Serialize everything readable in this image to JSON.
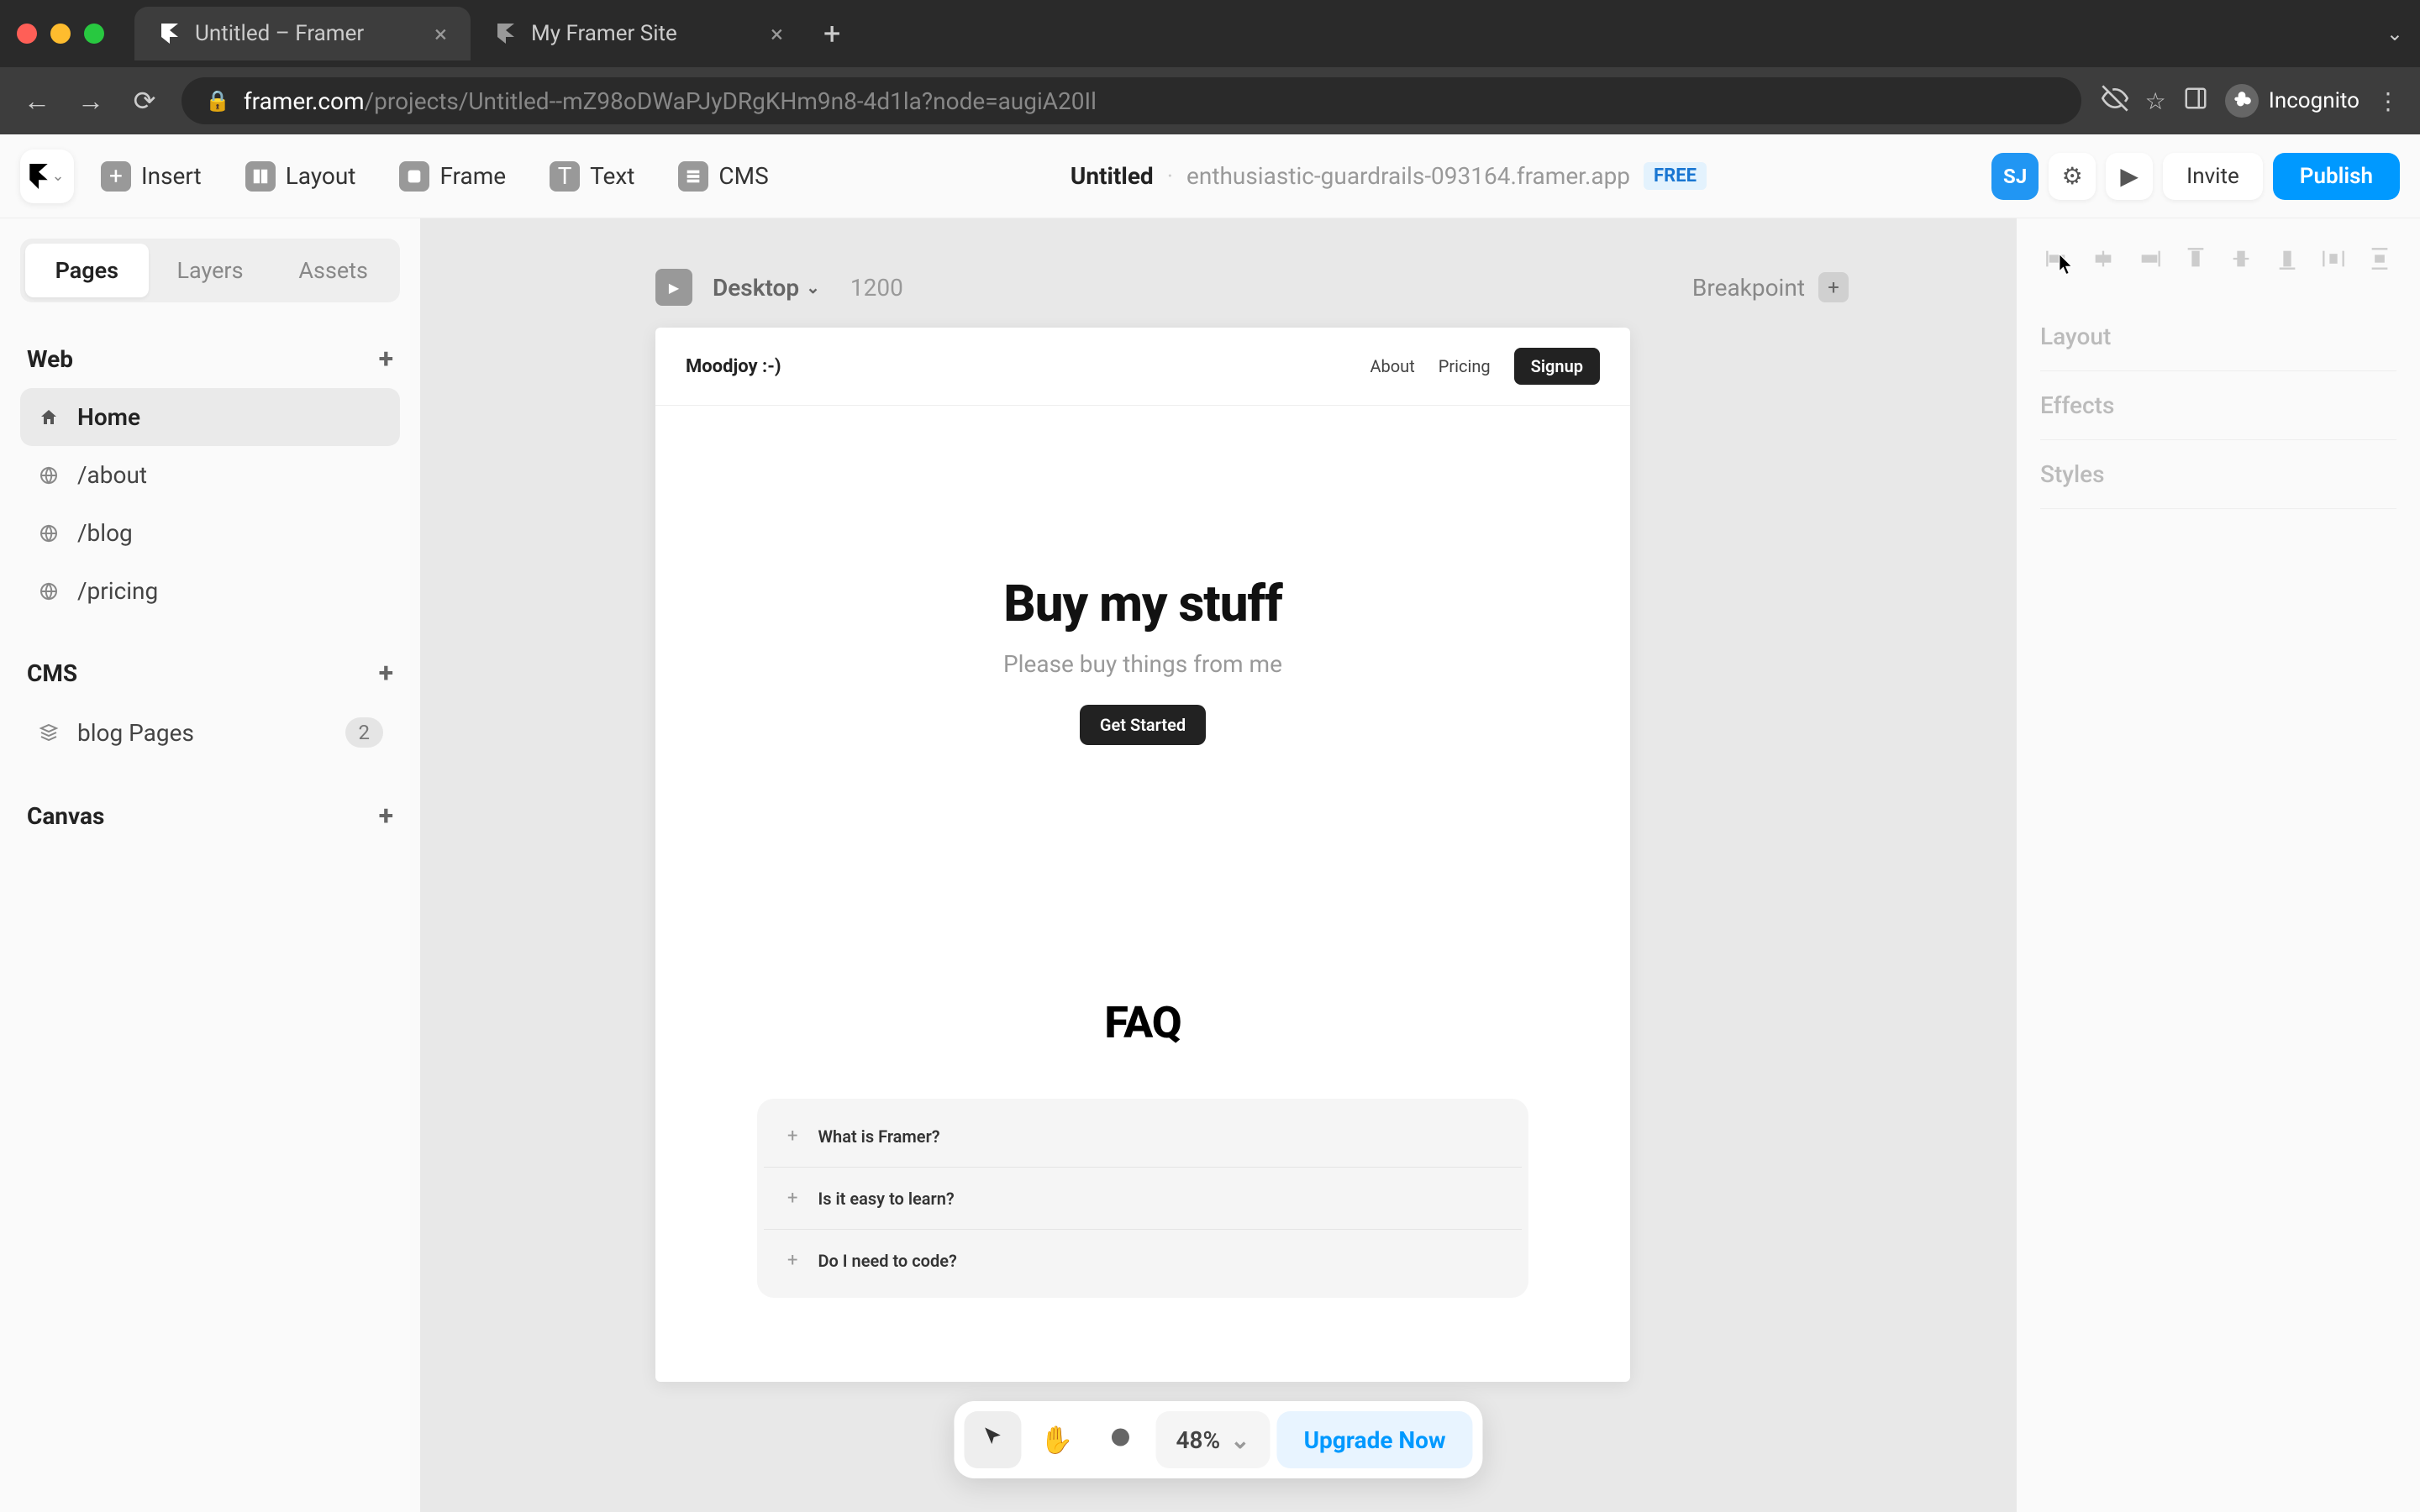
{
  "browser": {
    "tabs": [
      {
        "title": "Untitled – Framer",
        "active": true
      },
      {
        "title": "My Framer Site",
        "active": false
      }
    ],
    "url_host": "framer.com",
    "url_path": "/projects/Untitled--mZ98oDWaPJyDRgKHm9n8-4d1la?node=augiA20Il",
    "incognito_label": "Incognito"
  },
  "toolbar": {
    "items": [
      "Insert",
      "Layout",
      "Frame",
      "Text",
      "CMS"
    ],
    "project_name": "Untitled",
    "project_url": "enthusiastic-guardrails-093164.framer.app",
    "free_badge": "FREE",
    "avatar": "SJ",
    "invite": "Invite",
    "publish": "Publish"
  },
  "left": {
    "tabs": [
      "Pages",
      "Layers",
      "Assets"
    ],
    "active_tab": "Pages",
    "web_label": "Web",
    "pages": [
      {
        "label": "Home",
        "active": true,
        "icon": "home"
      },
      {
        "label": "/about",
        "active": false,
        "icon": "globe"
      },
      {
        "label": "/blog",
        "active": false,
        "icon": "globe"
      },
      {
        "label": "/pricing",
        "active": false,
        "icon": "globe"
      }
    ],
    "cms_label": "CMS",
    "cms_items": [
      {
        "label": "blog Pages",
        "count": "2"
      }
    ],
    "canvas_label": "Canvas"
  },
  "canvas": {
    "breakpoint_name": "Desktop",
    "breakpoint_width": "1200",
    "breakpoint_label": "Breakpoint",
    "site": {
      "logo": "Moodjoy :-)",
      "nav": [
        "About",
        "Pricing"
      ],
      "signup": "Signup",
      "hero_title": "Buy my stuff",
      "hero_sub": "Please buy things from me",
      "hero_cta": "Get Started",
      "faq_title": "FAQ",
      "faq_items": [
        "What is Framer?",
        "Is it easy to learn?",
        "Do I need to code?"
      ]
    }
  },
  "right": {
    "sections": [
      "Layout",
      "Effects",
      "Styles"
    ]
  },
  "floatbar": {
    "zoom": "48%",
    "upgrade": "Upgrade Now"
  },
  "colors": {
    "accent": "#0099ff"
  }
}
